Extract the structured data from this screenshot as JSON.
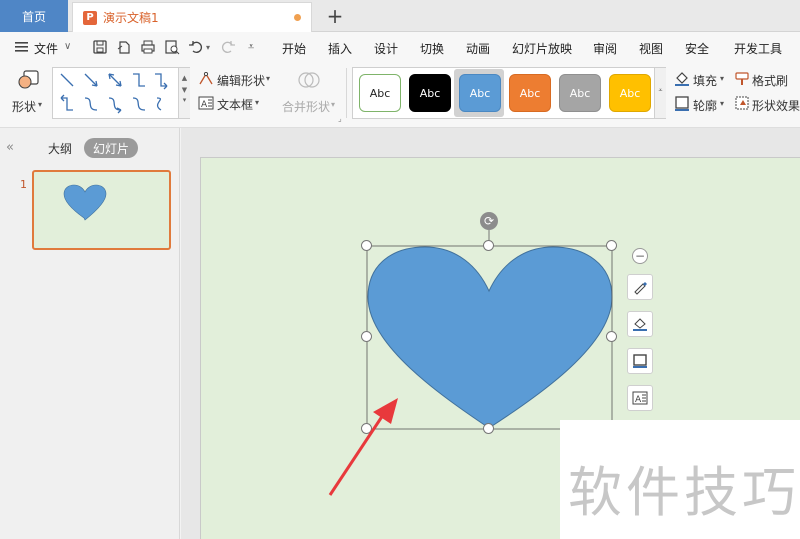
{
  "tabs": {
    "home": "首页",
    "document": "演示文稿1",
    "doc_icon": "P"
  },
  "menu": {
    "file": "文件",
    "items": [
      "开始",
      "插入",
      "设计",
      "切换",
      "动画",
      "幻灯片放映",
      "审阅",
      "视图",
      "安全",
      "开发工具"
    ]
  },
  "ribbon": {
    "shape_label": "形状",
    "edit_shape": "编辑形状",
    "text_box": "文本框",
    "merge_shapes": "合并形状",
    "style_swatches": [
      {
        "label": "Abc",
        "bg": "#ffffff",
        "fg": "#222222",
        "border": "#7fb46a"
      },
      {
        "label": "Abc",
        "bg": "#000000",
        "fg": "#ffffff",
        "border": "#000000"
      },
      {
        "label": "Abc",
        "bg": "#5b9bd5",
        "fg": "#ffffff",
        "border": "#4a88c2"
      },
      {
        "label": "Abc",
        "bg": "#ed7d31",
        "fg": "#ffffff",
        "border": "#d86b22"
      },
      {
        "label": "Abc",
        "bg": "#a5a5a5",
        "fg": "#ffffff",
        "border": "#909090"
      },
      {
        "label": "Abc",
        "bg": "#ffc000",
        "fg": "#ffffff",
        "border": "#e0a800"
      }
    ],
    "fill": "填充",
    "outline": "轮廓",
    "format_painter": "格式刷",
    "shape_effects": "形状效果"
  },
  "left_panel": {
    "outline_tab": "大纲",
    "slides_tab": "幻灯片",
    "slide_number": "1"
  },
  "colors": {
    "heart": "#5b9bd5",
    "slide_bg": "#e2efda",
    "accent": "#e07a3c",
    "arrow": "#e8393c"
  },
  "watermark": "软件技巧"
}
